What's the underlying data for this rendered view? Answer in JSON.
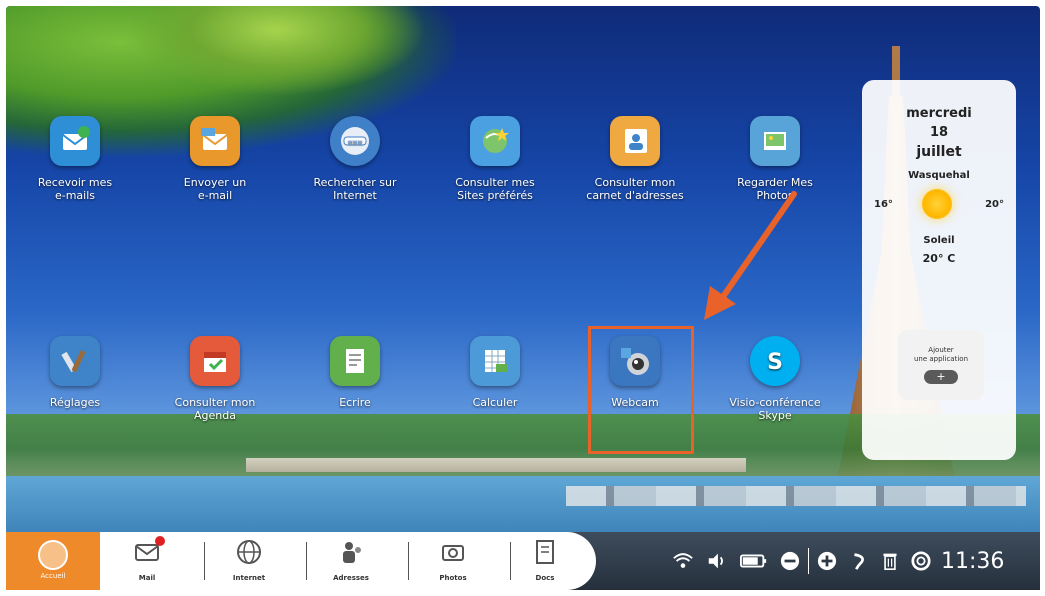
{
  "desktop": {
    "row1": [
      {
        "label_1": "Recevoir mes",
        "label_2": "e-mails",
        "icon": "mail-receive-icon",
        "color": "#2e8fd6"
      },
      {
        "label_1": "Envoyer un",
        "label_2": "e-mail",
        "icon": "mail-send-icon",
        "color": "#e9982c"
      },
      {
        "label_1": "Rechercher sur",
        "label_2": "Internet",
        "icon": "www-search-icon",
        "color": "#3f80c8"
      },
      {
        "label_1": "Consulter mes",
        "label_2": "Sites préférés",
        "icon": "favorite-sites-icon",
        "color": "#4aa0e0"
      },
      {
        "label_1": "Consulter mon",
        "label_2": "carnet d'adresses",
        "icon": "address-book-icon",
        "color": "#f0a840"
      },
      {
        "label_1": "Regarder Mes",
        "label_2": "Photos",
        "icon": "photos-icon",
        "color": "#58a4d8"
      }
    ],
    "row2": [
      {
        "label_1": "",
        "label_2": "Réglages",
        "icon": "settings-tools-icon",
        "color": "#3f84c9"
      },
      {
        "label_1": "Consulter mon",
        "label_2": "Agenda",
        "icon": "calendar-icon",
        "color": "#e55a3a"
      },
      {
        "label_1": "",
        "label_2": "Ecrire",
        "icon": "write-icon",
        "color": "#62b04c"
      },
      {
        "label_1": "",
        "label_2": "Calculer",
        "icon": "spreadsheet-icon",
        "color": "#4c9bd8"
      },
      {
        "label_1": "",
        "label_2": "Webcam",
        "icon": "webcam-icon",
        "color": "#3b77c0"
      },
      {
        "label_1": "Visio-conférence",
        "label_2": "Skype",
        "icon": "skype-icon",
        "color": "#00aff0"
      }
    ]
  },
  "weather": {
    "day": "mercredi",
    "date": "18",
    "month": "juillet",
    "city": "Wasquehal",
    "min": "16°",
    "max": "20°",
    "condition": "Soleil",
    "current": "20° C",
    "add_app_line1": "Ajouter",
    "add_app_line2": "une application",
    "add_symbol": "+"
  },
  "taskbar": {
    "home_label": "Accueil",
    "items": [
      "Mail",
      "Internet",
      "Adresses",
      "Photos",
      "Docs"
    ],
    "clock": "11:36"
  },
  "colors": {
    "accent": "#ef8a2a",
    "highlight": "#e8622a",
    "taskbar": "#2e3945"
  }
}
